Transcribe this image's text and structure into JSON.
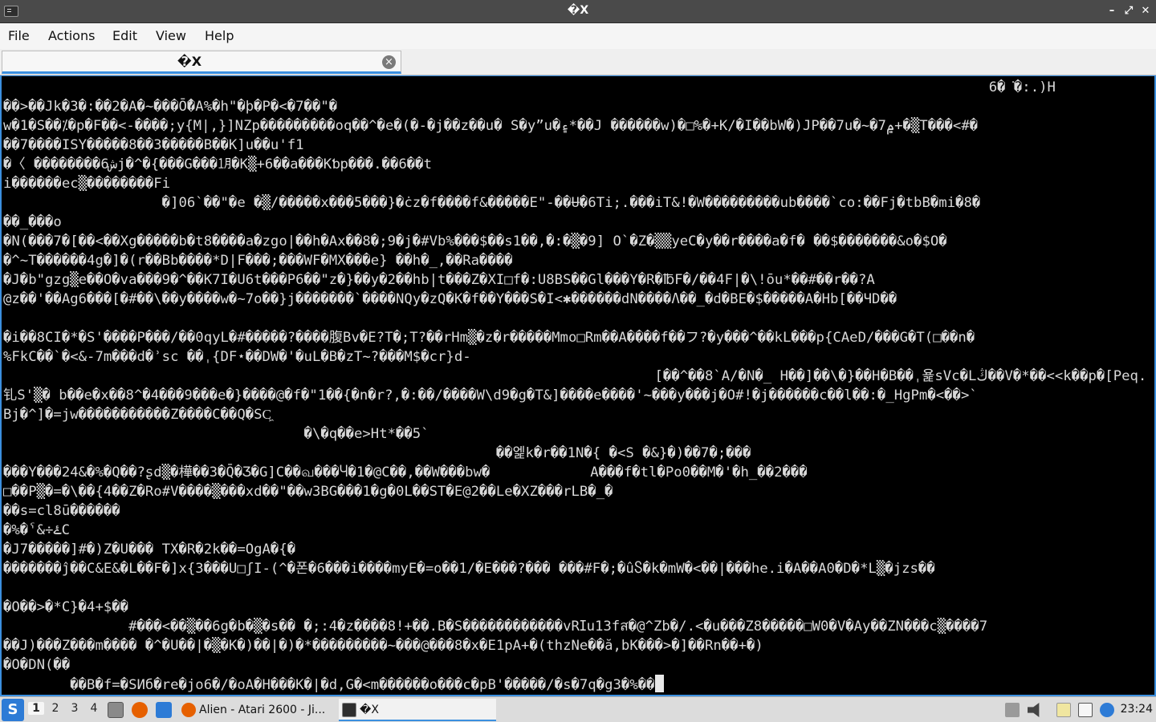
{
  "window": {
    "title": "�X",
    "minimize_glyph": "–",
    "maximize_glyph": "⤢",
    "close_glyph": "✕"
  },
  "menubar": {
    "items": [
      "File",
      "Actions",
      "Edit",
      "View",
      "Help"
    ]
  },
  "tab": {
    "label": "�X",
    "close_glyph": "×"
  },
  "terminal": {
    "lines": [
      "                                                                                                                      6�͘�:.)H",
      "��>��Jk�3�:��2�A�~���Ō̄�A%�h\"�þ�P�<�7��\"�",
      "w�1�S��⁒�p�F��<-����;y{M|,}]NZp���������oq��^�e�(�-�j��z��u� S�y”u�۽*��J ������w)�□%�+K/�I��bW�)JP��7u�~�7۾+�▒T���<#�",
      "��7����ISY�����8��3�����B��K]u��u'f1",
      "�〈 ��������6شj�^�{���G���㋀�K▒+6��a���Kƅp���.��6��t",
      "i������ec▒��������Fi",
      "                   �]06`��\"�e �▒/�����x���5���}�ċz�f����f&�����E\"-��Ʉ�6Ti;.���iT&!�W���������ub����`co:��Fj�tbB�mi�8�",
      "��_���o",
      "�N(���7�[��<��Xg�����b�t8����a�zgo|��h�Ax��8�;9�j�#Vb%���$��s1��,�:�▒�9] O`�Z�▒▒yeC�y��r����a�f� ��$�������&o�$O�",
      "�^~T������4g�]�(r��Bb����*D|F���;���WF�MX���e} ��h�_,��Ra����",
      "�J�b\"gzg▒e��O�va���9�^��K7I�U6t���P6��\"z�}��y�2��hb|t���Z�XI□f�:U8BS��Gl���Y�R�℔F�/��4F|�\\!ōu*��#��r��?A",
      "@z��'��Ag6���[�#��\\��y����w�~7o��}j�������`����NQy�zQ�K�f��Y���S�I<✱������dN����Λ��_�d�BE�$�����A�Hb[��ЧD��",
      "                                                                                                                                                  ��#Ш�G����",
      "�i��8CI�*�S'����P���/��0qyL�#�����?����腹Bv�E?T�;T?��rHm▒�z�r�����Mmo□Rm��A����f��フ?�y���^��kL���p{CAeD/���G�T(□��n�",
      "%FkC��`�<&-7m���d�ʾsc ��ˌ{DF⋆��DW�'�uL�B�zT~?���M$�cr}d-",
      "                                                                              [��^��8`A/�N�_ H��]��\\�}��H�B��ˌ욡sVc�Lڭ��V�*��<<k��p�[Peq.",
      "钆S'▒� b��e�x��8^�4���9���e�}����@�f�\"1��{�n�r?,�:��/����W\\d9�g�T&]����e����'~���y���j�O#!�j������c��l��:�_HgPm�<��>`",
      "Bj�^]�=jw�����������Z����C��Q�SC͖",
      "                                    �\\�q��e>Ht*��5`",
      "                                                           ��엝k�r��1N�{ �<S �&}�)��7�;���",
      "���Y���24&�%�Q��?ʂd▒�樺��3�Q̄�Ʒ�G]C��வ���Ⴗ�1�@C��,��W���bw�            A���f�tl�Po0��M�'�h_��2���",
      "□��P▒�=�\\��{4��Z�Ro#V����▒���xd��\"��w3BG���1�g�0L��ST�E@2��Le�XZ���rLB�_�",
      "��s=cl8ū������",
      "�%�ˁ&÷ۓC",
      "�J7�����]#�)Z�U��� TX�R�2k��=OgA�{�",
      "�������ĵ��C&E&�L��F�]x{3���U□ʃI-(^�폰�6���i����myE�=o��1/�E���?��� ���#F�;�ûႽ�k�mW�<��|���he.i�A��A0�D�*L▒�jzs��",
      "                                                                                                                                                 o7Q̣�",
      "�O��>�*C}�4+$��",
      "               #���<��▒��6g�b�▒�s�� �;:4�z����8!+��.B�S������������vRⵊu13fส�@^Zb�/.<�u���Z8�����□W0�V�Ay��ZN���c▒����7",
      "��J)���Z���m���� �^�U��|�▒�K�)��|�)�*���������~���@���8�x�E1pA+�(thzNe��ă,bK���>�]��Rn��+�)",
      "�O�DN(��",
      "        ��B�f=�SИб�re�jo6�/�oA�H���K�|�d,G�<m������o���c�pB'�����/�s�7q�g3�%��"
    ]
  },
  "taskbar": {
    "start_glyph": "S",
    "workspaces": [
      "1",
      "2",
      "3",
      "4"
    ],
    "tasks": [
      {
        "label": "Alien - Atari 2600 - Ji..."
      },
      {
        "label": "�X"
      }
    ],
    "clock": "23:24",
    "colors": {
      "accent": "#3b8fdf",
      "firefox": "#e66000"
    }
  }
}
